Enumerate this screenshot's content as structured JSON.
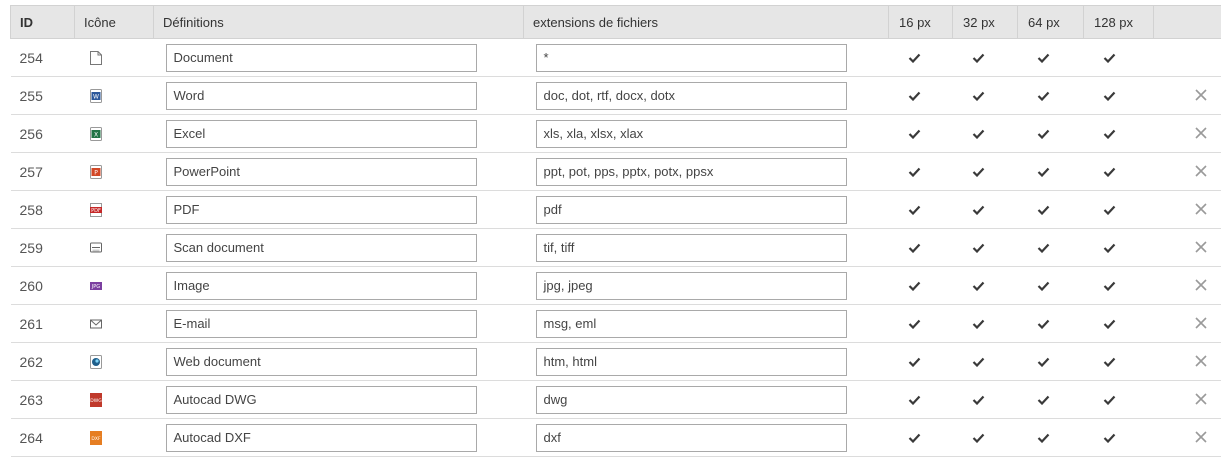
{
  "columns": {
    "id": "ID",
    "icon": "Icône",
    "definitions": "Définitions",
    "extensions": "extensions de fichiers",
    "s16": "16 px",
    "s32": "32 px",
    "s64": "64 px",
    "s128": "128 px"
  },
  "rows": [
    {
      "id": "254",
      "icon": "blank-document-icon",
      "name": "Document",
      "ext": "*",
      "deletable": false
    },
    {
      "id": "255",
      "icon": "word-icon",
      "name": "Word",
      "ext": "doc, dot, rtf, docx, dotx",
      "deletable": true
    },
    {
      "id": "256",
      "icon": "excel-icon",
      "name": "Excel",
      "ext": "xls, xla, xlsx, xlax",
      "deletable": true
    },
    {
      "id": "257",
      "icon": "powerpoint-icon",
      "name": "PowerPoint",
      "ext": "ppt, pot, pps, pptx, potx, ppsx",
      "deletable": true
    },
    {
      "id": "258",
      "icon": "pdf-icon",
      "name": "PDF",
      "ext": "pdf",
      "deletable": true
    },
    {
      "id": "259",
      "icon": "scan-document-icon",
      "name": "Scan document",
      "ext": "tif, tiff",
      "deletable": true
    },
    {
      "id": "260",
      "icon": "image-jpg-icon",
      "name": "Image",
      "ext": "jpg, jpeg",
      "deletable": true
    },
    {
      "id": "261",
      "icon": "email-envelope-icon",
      "name": "E-mail",
      "ext": "msg, eml",
      "deletable": true
    },
    {
      "id": "262",
      "icon": "web-document-icon",
      "name": "Web document",
      "ext": "htm, html",
      "deletable": true
    },
    {
      "id": "263",
      "icon": "autocad-dwg-icon",
      "name": "Autocad DWG",
      "ext": "dwg",
      "deletable": true
    },
    {
      "id": "264",
      "icon": "autocad-dxf-icon",
      "name": "Autocad DXF",
      "ext": "dxf",
      "deletable": true
    }
  ],
  "colors": {
    "header_bg": "#e6e6e6",
    "check": "#3a3a3a",
    "delete": "#9a9a9a",
    "word": "#2b579a",
    "excel": "#217346",
    "powerpoint": "#d24726",
    "pdf": "#c62828",
    "jpg": "#7b3fa0",
    "dwg": "#c0392b",
    "dxf": "#e67e22"
  }
}
